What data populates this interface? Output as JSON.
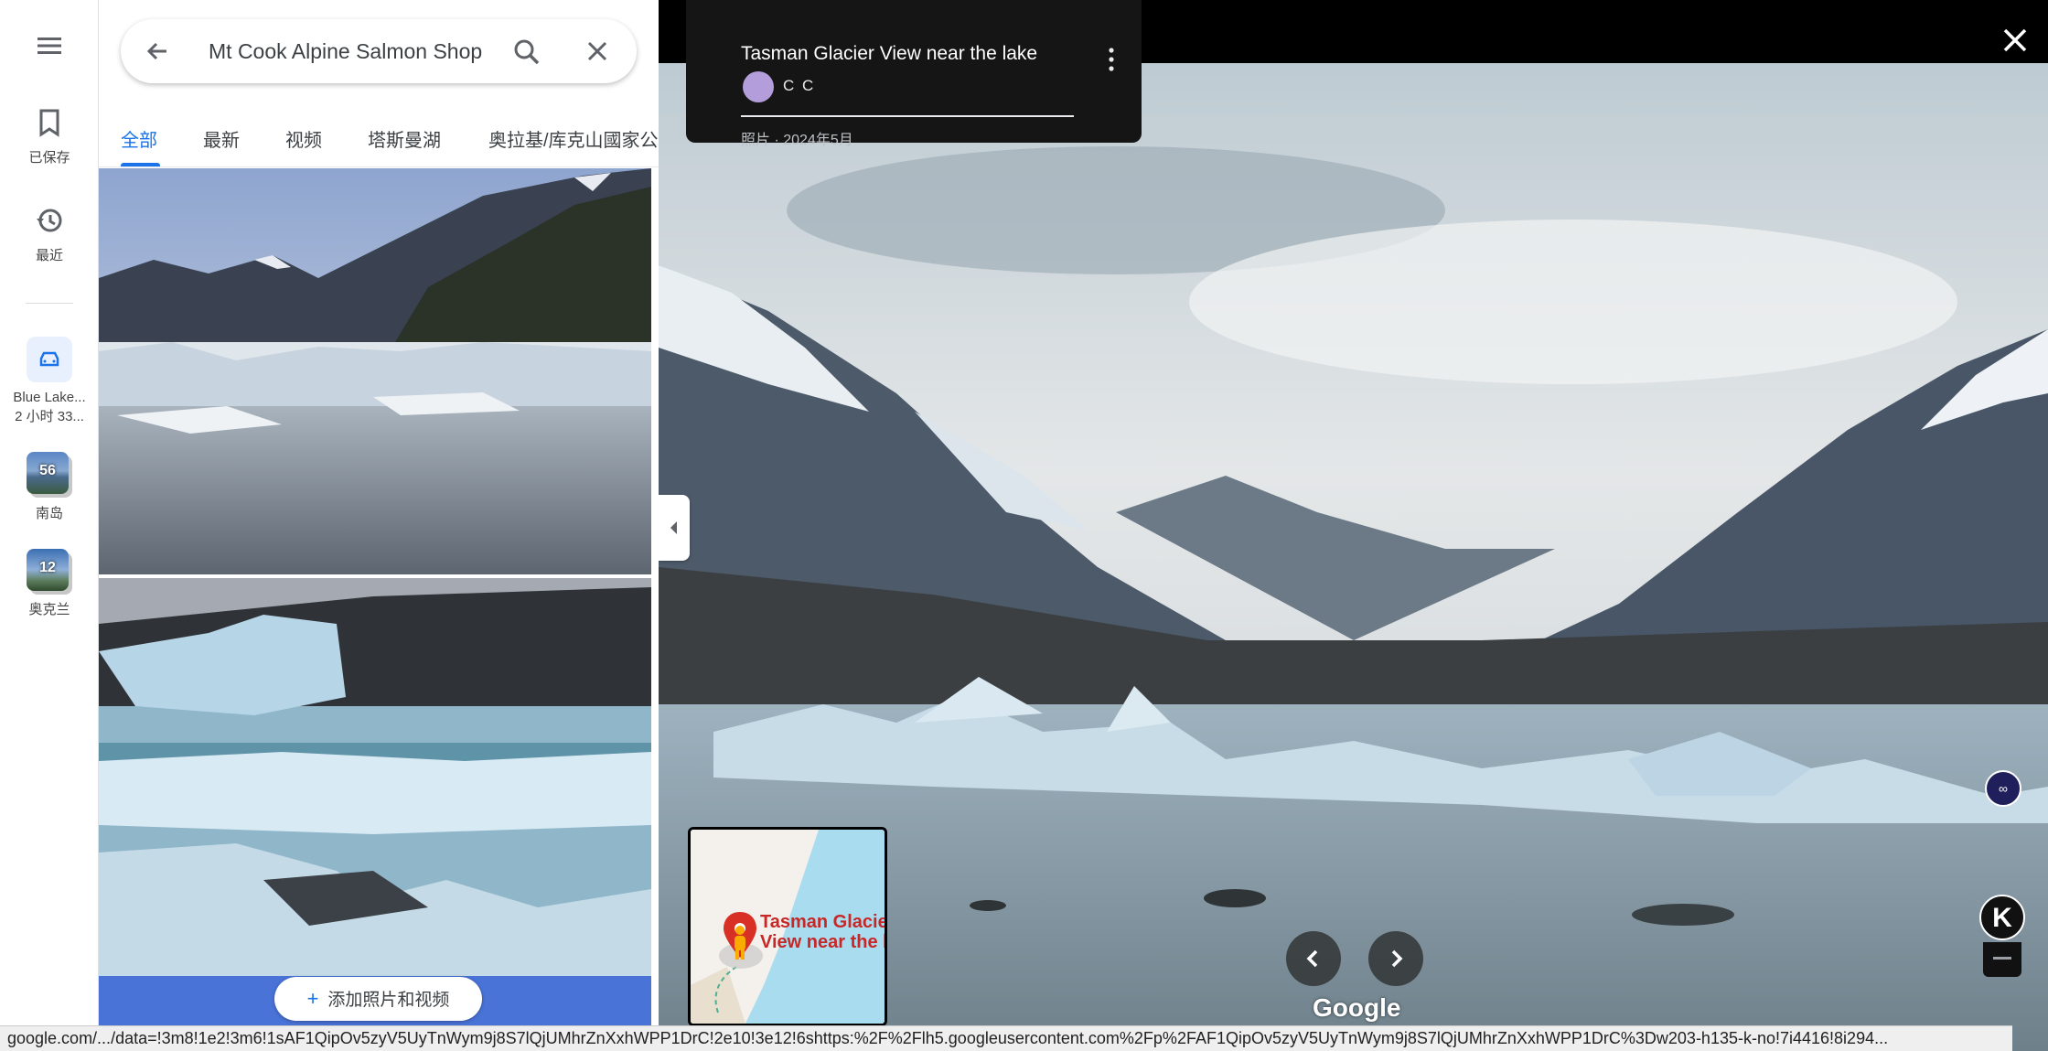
{
  "rail": {
    "saved_label": "已保存",
    "recent_label": "最近",
    "trip": {
      "title": "Blue Lake...",
      "subtitle": "2 小时 33..."
    },
    "recents": [
      {
        "count": "56",
        "label": "南岛"
      },
      {
        "count": "12",
        "label": "奥克兰"
      }
    ]
  },
  "search": {
    "query": "Mt Cook Alpine Salmon Shop"
  },
  "tabs": [
    {
      "label": "全部"
    },
    {
      "label": "最新"
    },
    {
      "label": "视频"
    },
    {
      "label": "塔斯曼湖"
    },
    {
      "label": "奥拉基/库克山國家公"
    }
  ],
  "panel": {
    "add_button": "添加照片和视频"
  },
  "viewer": {
    "title": "Tasman Glacier View near the lake",
    "author": "C C",
    "date": "照片 · 2024年5月",
    "minimap_label_line1": "Tasman Glacie",
    "minimap_label_line2": "View near the l",
    "brand": "Google",
    "k_button": "K"
  },
  "statusbar": {
    "url": "google.com/.../data=!3m8!1e2!3m6!1sAF1QipOv5zyV5UyTnWym9j8S7lQjUMhrZnXxhWPP1DrC!2e10!3e12!6shttps:%2F%2Flh5.googleusercontent.com%2Fp%2FAF1QipOv5zyV5UyTnWym9j8S7lQjUMhrZnXxhWPP1DrC%3Dw203-h135-k-no!7i4416!8i294..."
  },
  "colors": {
    "accent": "#1a73e8",
    "add_bar": "#4a73d8",
    "viewer_bg": "#000000"
  }
}
